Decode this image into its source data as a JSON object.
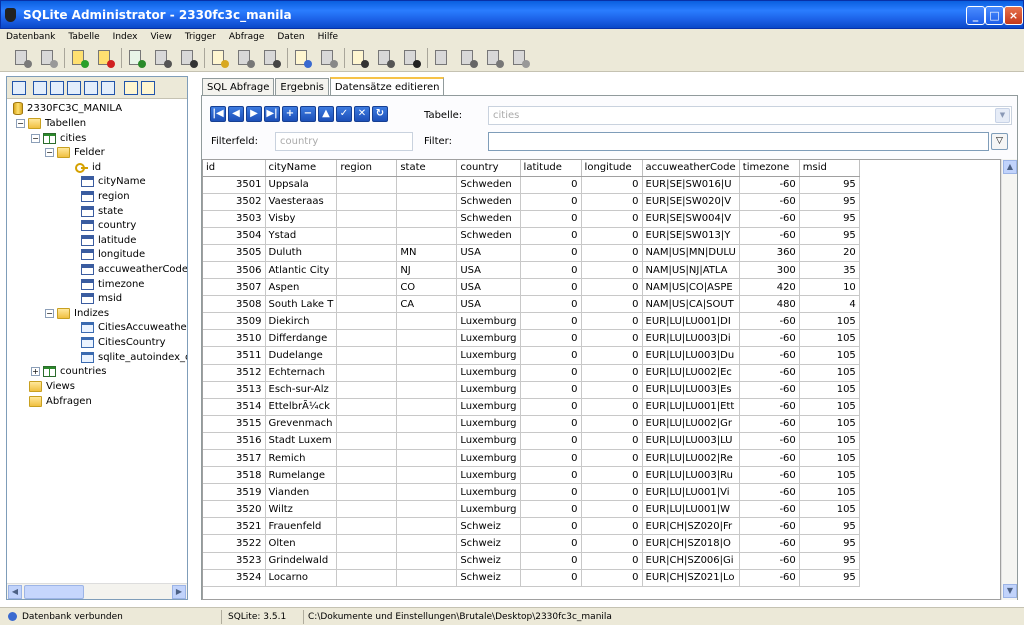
{
  "window": {
    "title": "SQLite Administrator - 2330fc3c_manila"
  },
  "menu": [
    "Datenbank",
    "Tabelle",
    "Index",
    "View",
    "Trigger",
    "Abfrage",
    "Daten",
    "Hilfe"
  ],
  "tree": {
    "root": "2330FC3C_MANILA",
    "tables_label": "Tabellen",
    "table_cities": "cities",
    "fields_label": "Felder",
    "fields": [
      "id",
      "cityName",
      "region",
      "state",
      "country",
      "latitude",
      "longitude",
      "accuweatherCode",
      "timezone",
      "msid"
    ],
    "indices_label": "Indizes",
    "indices": [
      "CitiesAccuweatherCo",
      "CitiesCountry",
      "sqlite_autoindex_citi"
    ],
    "table_countries": "countries",
    "views_label": "Views",
    "queries_label": "Abfragen"
  },
  "tabs": [
    "SQL Abfrage",
    "Ergebnis",
    "Datensätze editieren"
  ],
  "editor": {
    "table_label": "Tabelle:",
    "table_value": "cities",
    "filterfield_label": "Filterfeld:",
    "filterfield_value": "country",
    "filter_label": "Filter:",
    "filter_value": ""
  },
  "grid": {
    "columns": [
      "id",
      "cityName",
      "region",
      "state",
      "country",
      "latitude",
      "longitude",
      "accuweatherCode",
      "timezone",
      "msid"
    ],
    "rows": [
      [
        "3501",
        "Uppsala",
        "",
        "",
        "Schweden",
        "0",
        "0",
        "EUR|SE|SW016|U",
        "-60",
        "95"
      ],
      [
        "3502",
        "Vaesteraas",
        "",
        "",
        "Schweden",
        "0",
        "0",
        "EUR|SE|SW020|V",
        "-60",
        "95"
      ],
      [
        "3503",
        "Visby",
        "",
        "",
        "Schweden",
        "0",
        "0",
        "EUR|SE|SW004|V",
        "-60",
        "95"
      ],
      [
        "3504",
        "Ystad",
        "",
        "",
        "Schweden",
        "0",
        "0",
        "EUR|SE|SW013|Y",
        "-60",
        "95"
      ],
      [
        "3505",
        "Duluth",
        "",
        "MN",
        "USA",
        "0",
        "0",
        "NAM|US|MN|DULU",
        "360",
        "20"
      ],
      [
        "3506",
        "Atlantic City",
        "",
        "NJ",
        "USA",
        "0",
        "0",
        "NAM|US|NJ|ATLA",
        "300",
        "35"
      ],
      [
        "3507",
        "Aspen",
        "",
        "CO",
        "USA",
        "0",
        "0",
        "NAM|US|CO|ASPE",
        "420",
        "10"
      ],
      [
        "3508",
        "South Lake T",
        "",
        "CA",
        "USA",
        "0",
        "0",
        "NAM|US|CA|SOUT",
        "480",
        "4"
      ],
      [
        "3509",
        "Diekirch",
        "",
        "",
        "Luxemburg",
        "0",
        "0",
        "EUR|LU|LU001|DI",
        "-60",
        "105"
      ],
      [
        "3510",
        "Differdange",
        "",
        "",
        "Luxemburg",
        "0",
        "0",
        "EUR|LU|LU003|Di",
        "-60",
        "105"
      ],
      [
        "3511",
        "Dudelange",
        "",
        "",
        "Luxemburg",
        "0",
        "0",
        "EUR|LU|LU003|Du",
        "-60",
        "105"
      ],
      [
        "3512",
        "Echternach",
        "",
        "",
        "Luxemburg",
        "0",
        "0",
        "EUR|LU|LU002|Ec",
        "-60",
        "105"
      ],
      [
        "3513",
        "Esch-sur-Alz",
        "",
        "",
        "Luxemburg",
        "0",
        "0",
        "EUR|LU|LU003|Es",
        "-60",
        "105"
      ],
      [
        "3514",
        "EttelbrÃ¼ck",
        "",
        "",
        "Luxemburg",
        "0",
        "0",
        "EUR|LU|LU001|Ett",
        "-60",
        "105"
      ],
      [
        "3515",
        "Grevenmach",
        "",
        "",
        "Luxemburg",
        "0",
        "0",
        "EUR|LU|LU002|Gr",
        "-60",
        "105"
      ],
      [
        "3516",
        "Stadt Luxem",
        "",
        "",
        "Luxemburg",
        "0",
        "0",
        "EUR|LU|LU003|LU",
        "-60",
        "105"
      ],
      [
        "3517",
        "Remich",
        "",
        "",
        "Luxemburg",
        "0",
        "0",
        "EUR|LU|LU002|Re",
        "-60",
        "105"
      ],
      [
        "3518",
        "Rumelange",
        "",
        "",
        "Luxemburg",
        "0",
        "0",
        "EUR|LU|LU003|Ru",
        "-60",
        "105"
      ],
      [
        "3519",
        "Vianden",
        "",
        "",
        "Luxemburg",
        "0",
        "0",
        "EUR|LU|LU001|Vi",
        "-60",
        "105"
      ],
      [
        "3520",
        "Wiltz",
        "",
        "",
        "Luxemburg",
        "0",
        "0",
        "EUR|LU|LU001|W",
        "-60",
        "105"
      ],
      [
        "3521",
        "Frauenfeld",
        "",
        "",
        "Schweiz",
        "0",
        "0",
        "EUR|CH|SZ020|Fr",
        "-60",
        "95"
      ],
      [
        "3522",
        "Olten",
        "",
        "",
        "Schweiz",
        "0",
        "0",
        "EUR|CH|SZ018|O",
        "-60",
        "95"
      ],
      [
        "3523",
        "Grindelwald",
        "",
        "",
        "Schweiz",
        "0",
        "0",
        "EUR|CH|SZ006|Gi",
        "-60",
        "95"
      ],
      [
        "3524",
        "Locarno",
        "",
        "",
        "Schweiz",
        "0",
        "0",
        "EUR|CH|SZ021|Lo",
        "-60",
        "95"
      ]
    ]
  },
  "status": {
    "connection": "Datenbank verbunden",
    "version": "SQLite: 3.5.1",
    "path": "C:\\Dokumente und Einstellungen\\Brutale\\Desktop\\2330fc3c_manila"
  }
}
